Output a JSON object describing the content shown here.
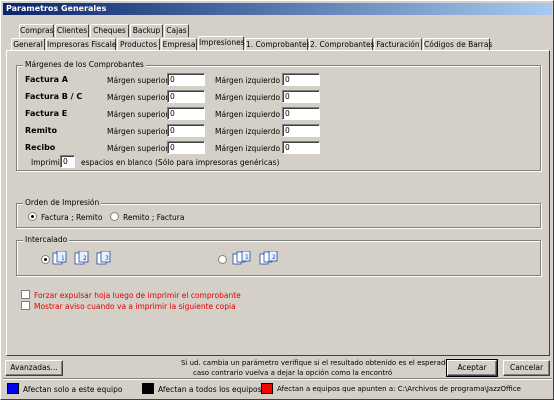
{
  "window": {
    "title": "Parametros Generales"
  },
  "tabs_row1": [
    "Compras",
    "Clientes",
    "Cheques",
    "Backup",
    "Cajas"
  ],
  "tabs_row2": [
    "General",
    "Impresoras Fiscales",
    "Productos",
    "Empresa",
    "Impresiones",
    "1. Comprobantes",
    "2. Comprobantes",
    "Facturación",
    "Códigos de Barras"
  ],
  "active_tab": "Impresiones",
  "margins": {
    "group_title": "Márgenes de los Comprobantes",
    "top_label": "Márgen superior",
    "left_label": "Márgen izquierdo",
    "rows": [
      {
        "name": "Factura A",
        "top": "0",
        "left": "0"
      },
      {
        "name": "Factura B / C",
        "top": "0",
        "left": "0"
      },
      {
        "name": "Factura E",
        "top": "0",
        "left": "0"
      },
      {
        "name": "Remito",
        "top": "0",
        "left": "0"
      },
      {
        "name": "Recibo",
        "top": "0",
        "left": "0"
      }
    ],
    "print_prefix": "Imprimir",
    "print_value": "0",
    "print_suffix": "espacios en blanco (Sólo para impresoras genéricas)"
  },
  "order": {
    "group_title": "Orden de Impresión",
    "option1": "Factura ; Remito",
    "option2": "Remito ; Factura",
    "selected": "option1"
  },
  "interleave": {
    "group_title": "Intercalado",
    "selected": "option1"
  },
  "checks": {
    "eject": "Forzar expulsar hoja luego de imprimir el comprobante",
    "warn": "Mostrar aviso cuando va a imprimir la siguiente copia"
  },
  "footer": {
    "advanced": "Avanzadas...",
    "note_line1": "Si ud. cambia un parámetro verifique si el resultado obtenido es el esperado,",
    "note_line2": "caso contrario vuelva a dejar la opción como la encontró",
    "accept": "Aceptar",
    "cancel": "Cancelar"
  },
  "legend": {
    "blue": "Afectan solo a este equipo",
    "black": "Afectan a todos los equipos",
    "red": "Afectan a equipos que apunten a: C:\\Archivos de programa\\JazzOffice",
    "colors": {
      "blue": "#0000ff",
      "black": "#000000",
      "red": "#ff0000"
    }
  }
}
